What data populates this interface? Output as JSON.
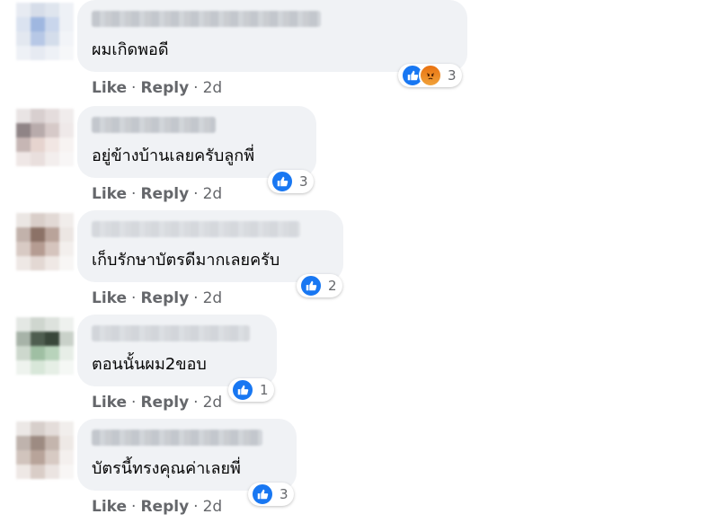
{
  "actions": {
    "like": "Like",
    "reply": "Reply",
    "separator": "·"
  },
  "comments": [
    {
      "text": "ผมเกิดพอดี",
      "reactions": [
        "like-icon",
        "angry-icon"
      ],
      "count": "3",
      "time": "2d"
    },
    {
      "text": "อยู่ข้างบ้านเลยครับลูกพี่",
      "reactions": [
        "like-icon"
      ],
      "count": "3",
      "time": "2d"
    },
    {
      "text": "เก็บรักษาบัตรดีมากเลยครับ",
      "reactions": [
        "like-icon"
      ],
      "count": "2",
      "time": "2d"
    },
    {
      "text": "ตอนนั้นผม2ขอบ",
      "reactions": [
        "like-icon"
      ],
      "count": "1",
      "time": "2d"
    },
    {
      "text": "บัตรนี้ทรงคุณค่าเลยพี่",
      "reactions": [
        "like-icon"
      ],
      "count": "3",
      "time": "2d"
    }
  ],
  "colors": {
    "like": "#1877f2",
    "angry": "#e9710f",
    "bubble": "#f0f2f5",
    "meta": "#65676b"
  }
}
